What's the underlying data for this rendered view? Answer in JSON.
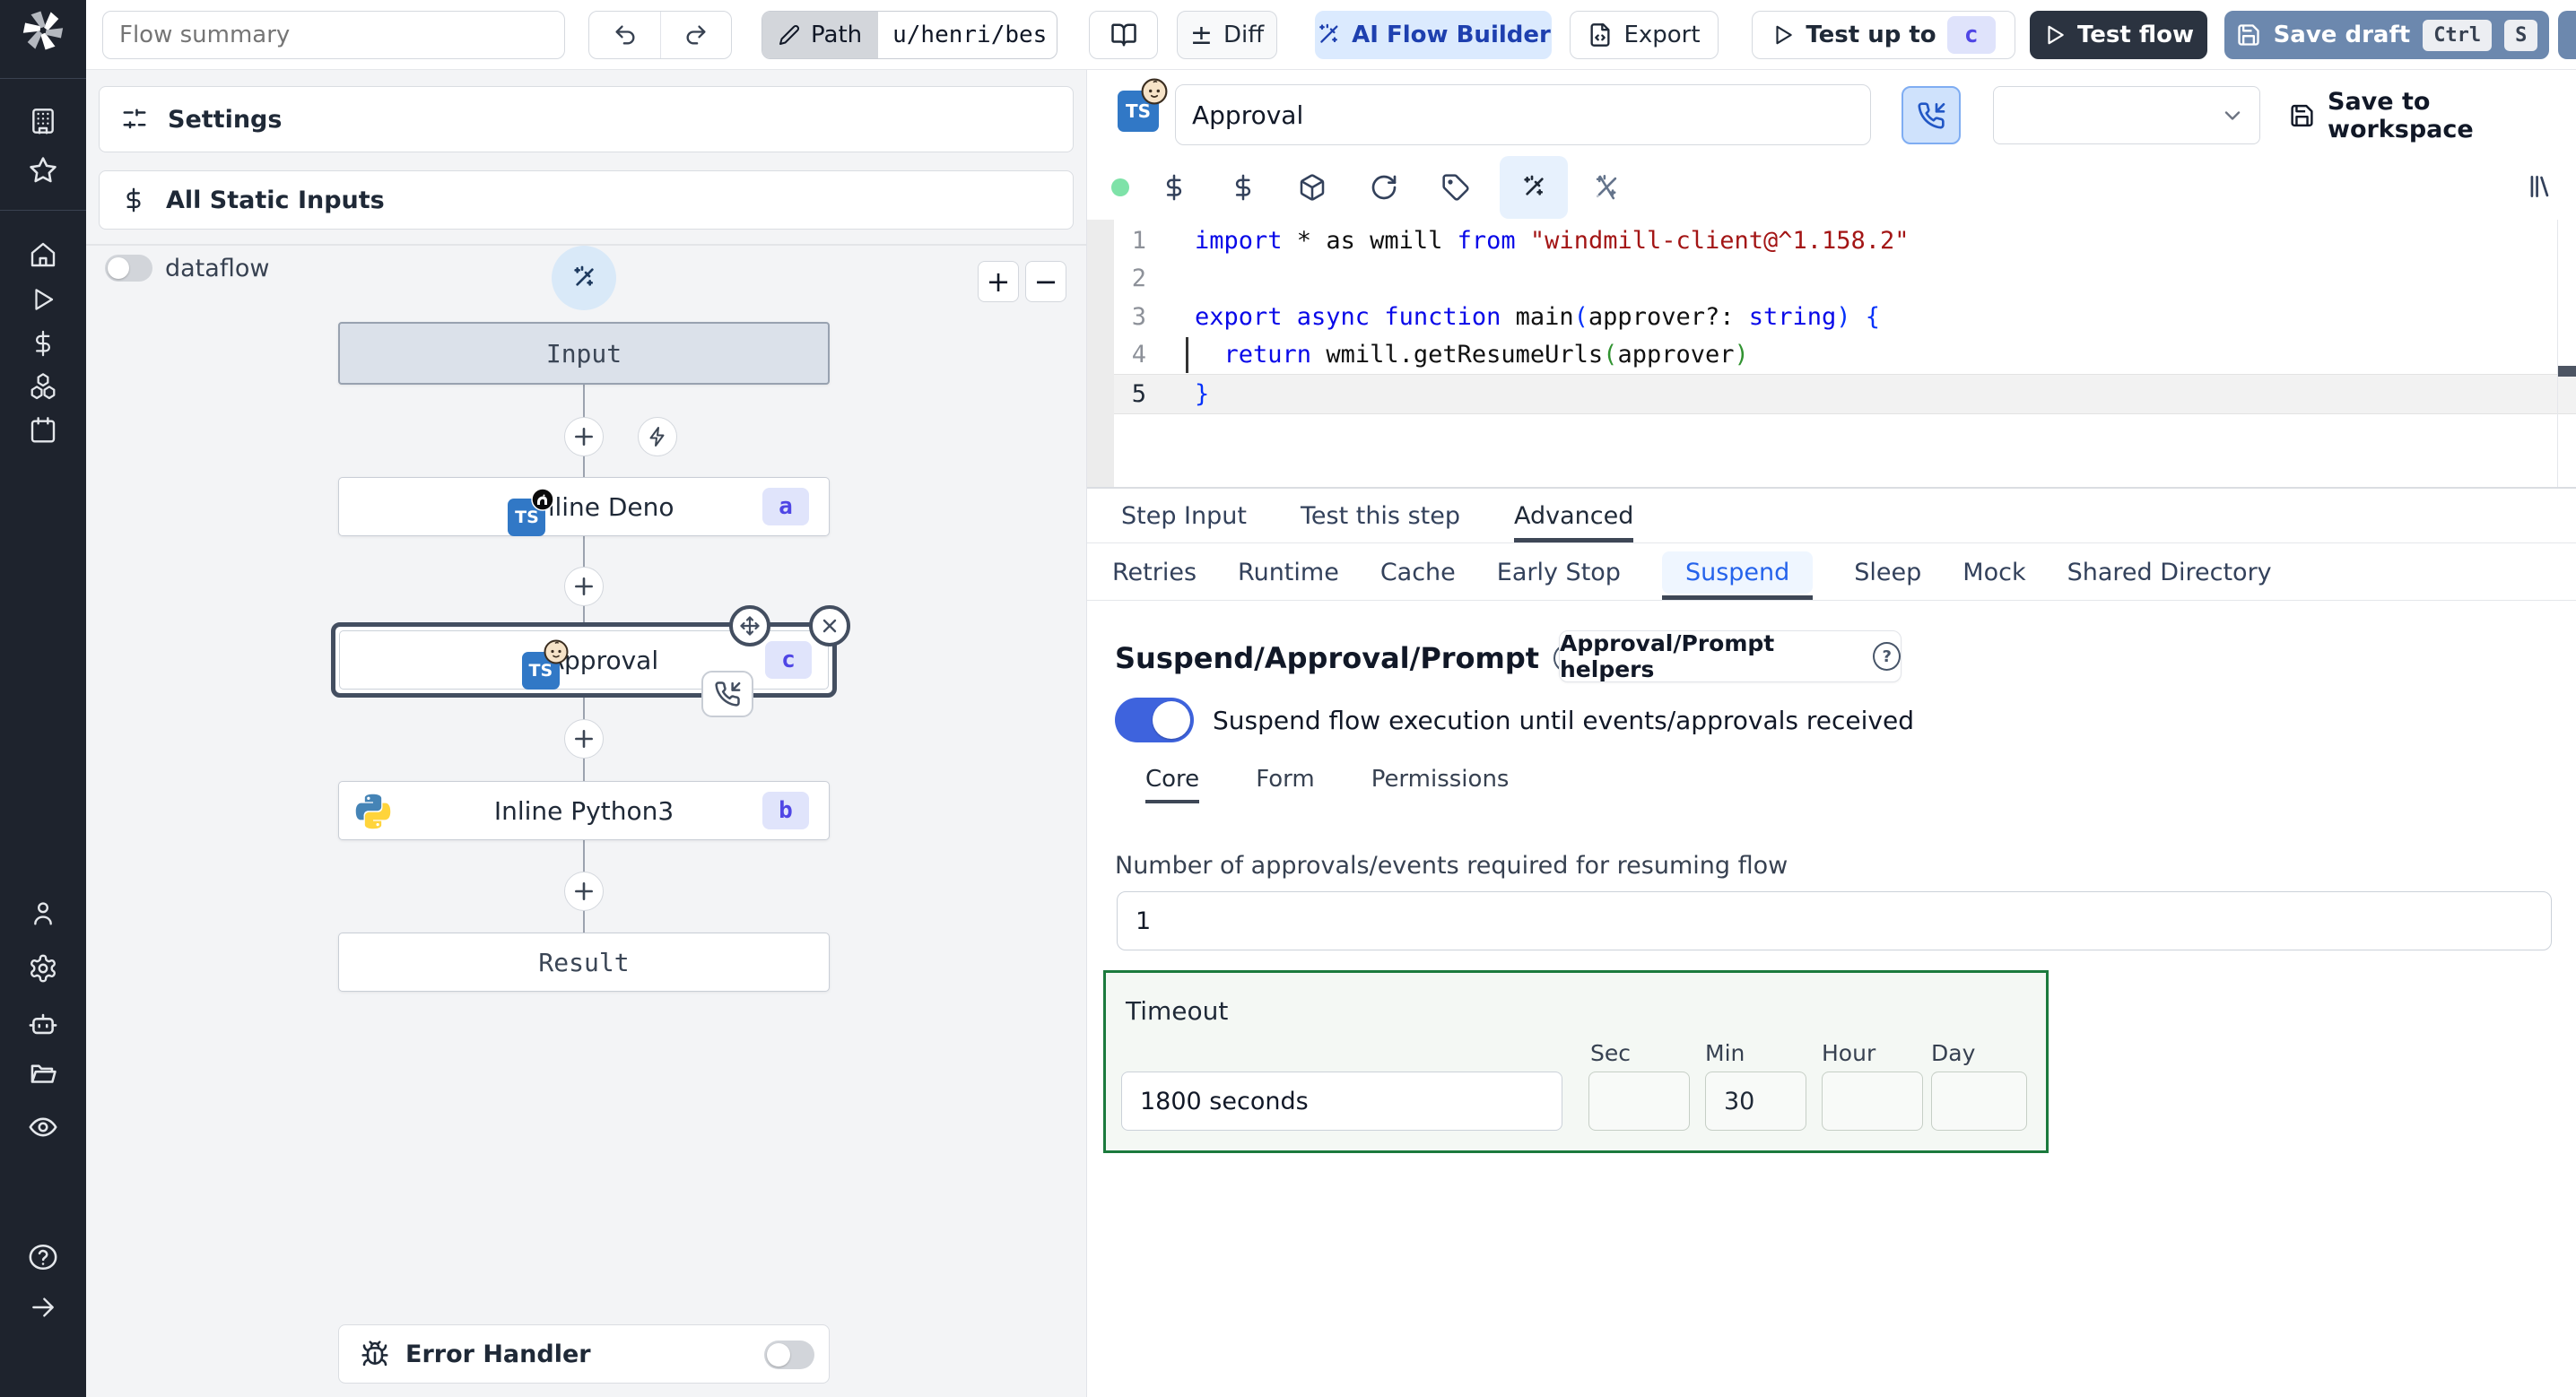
{
  "topbar": {
    "flow_summary_placeholder": "Flow summary",
    "path_label": "Path",
    "path_value": "u/henri/bes",
    "diff_symbol": "±",
    "diff_label": "Diff",
    "ai_flow_builder_label": "AI Flow Builder",
    "export_label": "Export",
    "test_up_to_label": "Test up to",
    "test_up_to_badge": "c",
    "test_flow_label": "Test flow",
    "save_draft_label": "Save draft",
    "save_draft_kbd": [
      "Ctrl",
      "S"
    ]
  },
  "sidebar": {
    "icons": [
      "building",
      "star",
      "home",
      "play",
      "dollar",
      "boxes",
      "calendar",
      "user",
      "settings-gear",
      "bot",
      "folder-open",
      "eye",
      "help",
      "collapse-arrow"
    ]
  },
  "left_panel": {
    "settings_label": "Settings",
    "static_inputs_label": "All Static Inputs",
    "dataflow_label": "dataflow",
    "zoom_in": "+",
    "zoom_out": "−",
    "error_handler_label": "Error Handler"
  },
  "flow": {
    "nodes": [
      {
        "label": "Input"
      },
      {
        "label": "Inline Deno",
        "badge": "a",
        "lang": "deno-typescript"
      },
      {
        "label": "Approval",
        "badge": "c",
        "lang": "bun-typescript",
        "selected": true
      },
      {
        "label": "Inline Python3",
        "badge": "b",
        "lang": "python3"
      },
      {
        "label": "Result"
      }
    ]
  },
  "step": {
    "name_value": "Approval",
    "save_to_workspace": "Save to workspace"
  },
  "editor": {
    "lines": [
      {
        "num": "1",
        "tokens": [
          [
            "import",
            "kw"
          ],
          [
            " * as wmill ",
            "pl"
          ],
          [
            "from",
            "kw"
          ],
          [
            " ",
            "pl"
          ],
          [
            "\"windmill-client@^1.158.2\"",
            "str"
          ]
        ]
      },
      {
        "num": "2",
        "tokens": []
      },
      {
        "num": "3",
        "tokens": [
          [
            "export async function",
            "kw"
          ],
          [
            " main",
            "pl"
          ],
          [
            "(",
            "b1"
          ],
          [
            "approver?: ",
            "pl"
          ],
          [
            "string",
            "kw"
          ],
          [
            ")",
            "b1"
          ],
          [
            " {",
            "b1"
          ]
        ]
      },
      {
        "num": "4",
        "tokens": [
          [
            "  ",
            "pl"
          ],
          [
            "return",
            "kw"
          ],
          [
            " wmill.getResumeUrls",
            "pl"
          ],
          [
            "(",
            "b2"
          ],
          [
            "approver",
            "pl"
          ],
          [
            ")",
            "b2"
          ]
        ]
      },
      {
        "num": "5",
        "active": true,
        "tokens": [
          [
            "}",
            "b1"
          ]
        ]
      }
    ]
  },
  "tabs": {
    "primary": [
      {
        "label": "Step Input"
      },
      {
        "label": "Test this step"
      },
      {
        "label": "Advanced",
        "active": true
      }
    ],
    "secondary": [
      {
        "label": "Retries"
      },
      {
        "label": "Runtime"
      },
      {
        "label": "Cache"
      },
      {
        "label": "Early Stop"
      },
      {
        "label": "Suspend",
        "active": true
      },
      {
        "label": "Sleep"
      },
      {
        "label": "Mock"
      },
      {
        "label": "Shared Directory"
      }
    ]
  },
  "suspend": {
    "title": "Suspend/Approval/Prompt",
    "helpers_button": "Approval/Prompt helpers",
    "toggle_label": "Suspend flow execution until events/approvals received",
    "sub_tabs": [
      {
        "label": "Core",
        "active": true
      },
      {
        "label": "Form"
      },
      {
        "label": "Permissions"
      }
    ],
    "approvals_label": "Number of approvals/events required for resuming flow",
    "approvals_value": "1",
    "timeout": {
      "legend": "Timeout",
      "main_value": "1800 seconds",
      "units": [
        "Sec",
        "Min",
        "Hour",
        "Day"
      ],
      "values": {
        "sec": "",
        "min": "30",
        "hour": "",
        "day": ""
      }
    }
  },
  "colors": {
    "toggle_on_blue": "#3e63dd",
    "save_draft_blue": "#6c88ae",
    "test_flow_dark": "#2b3340",
    "ai_builder_bg": "#dbeafe",
    "ai_builder_text": "#1e40af",
    "suspend_tab_blue": "#2563eb",
    "timeout_border_green": "#1b7a3d",
    "badge_bg": "#e0e4fb",
    "badge_text": "#4f46e5",
    "ts_logo_blue": "#3178c6",
    "keyword_blue": "#0808e8",
    "string_red": "#a31515"
  }
}
